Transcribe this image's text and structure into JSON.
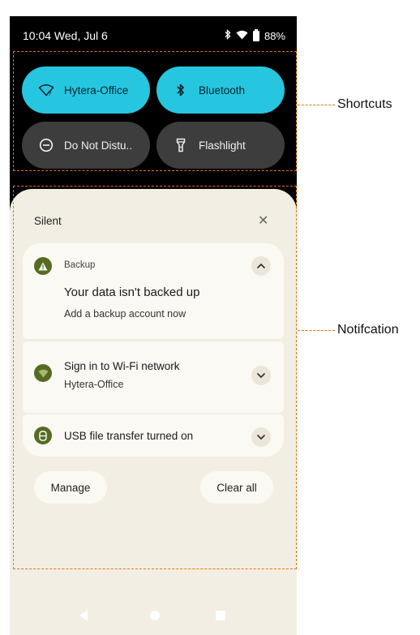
{
  "status_bar": {
    "time": "10:04 Wed, Jul 6",
    "battery": "88%",
    "icons": [
      "bluetooth-icon",
      "wifi-icon",
      "battery-icon"
    ]
  },
  "quick_settings": {
    "tiles": [
      {
        "label": "Hytera-Office",
        "icon": "wifi-icon",
        "state": "on"
      },
      {
        "label": "Bluetooth",
        "icon": "bluetooth-icon",
        "state": "on"
      },
      {
        "label": "Do Not Distu..",
        "icon": "do-not-disturb-icon",
        "state": "off"
      },
      {
        "label": "Flashlight",
        "icon": "flashlight-icon",
        "state": "off"
      }
    ]
  },
  "notifications": {
    "section_label": "Silent",
    "items": [
      {
        "app": "Backup",
        "title": "Your data isn't backed up",
        "text": "Add a backup account now",
        "icon": "warning-icon",
        "expanded": true
      },
      {
        "title": "Sign in to Wi-Fi network",
        "text": "Hytera-Office",
        "icon": "wifi-icon",
        "expanded": false
      },
      {
        "title": "USB file transfer turned on",
        "icon": "usb-icon",
        "expanded": false
      }
    ],
    "manage_label": "Manage",
    "clear_all_label": "Clear all"
  },
  "annotations": {
    "shortcuts_label": "Shortcuts",
    "notification_label": "Notifcation"
  },
  "colors": {
    "tile_active": "#26c6e0",
    "tile_inactive": "#3d3d3d",
    "shade_background": "#f2eee4",
    "card_background": "#fbf9f3",
    "app_icon": "#556b22",
    "annotation_border": "#e8740c"
  }
}
